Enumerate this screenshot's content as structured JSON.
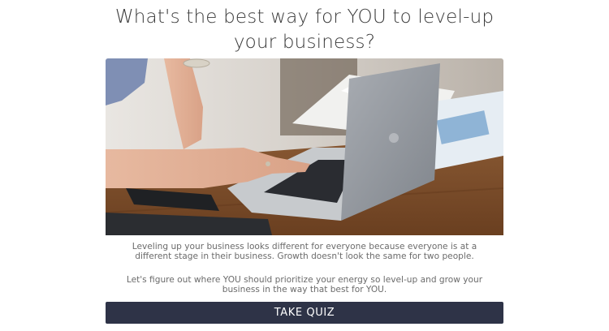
{
  "header": {
    "title": "What's the best way for YOU to level-up your business?"
  },
  "hero": {
    "image_alt": "woman typing on a laptop"
  },
  "content": {
    "paragraph_1": "Leveling up your business looks different for everyone because everyone is at a different stage in their business. Growth doesn't look the same for two people.",
    "paragraph_2": "Let's figure out where YOU should prioritize your energy so level-up and grow your business in the way that best for YOU."
  },
  "cta": {
    "label": "TAKE QUIZ"
  },
  "colors": {
    "button_bg": "#2e3347",
    "button_text": "#ffffff",
    "title_text": "#3a3a3a",
    "body_text": "#6b6b6b"
  }
}
